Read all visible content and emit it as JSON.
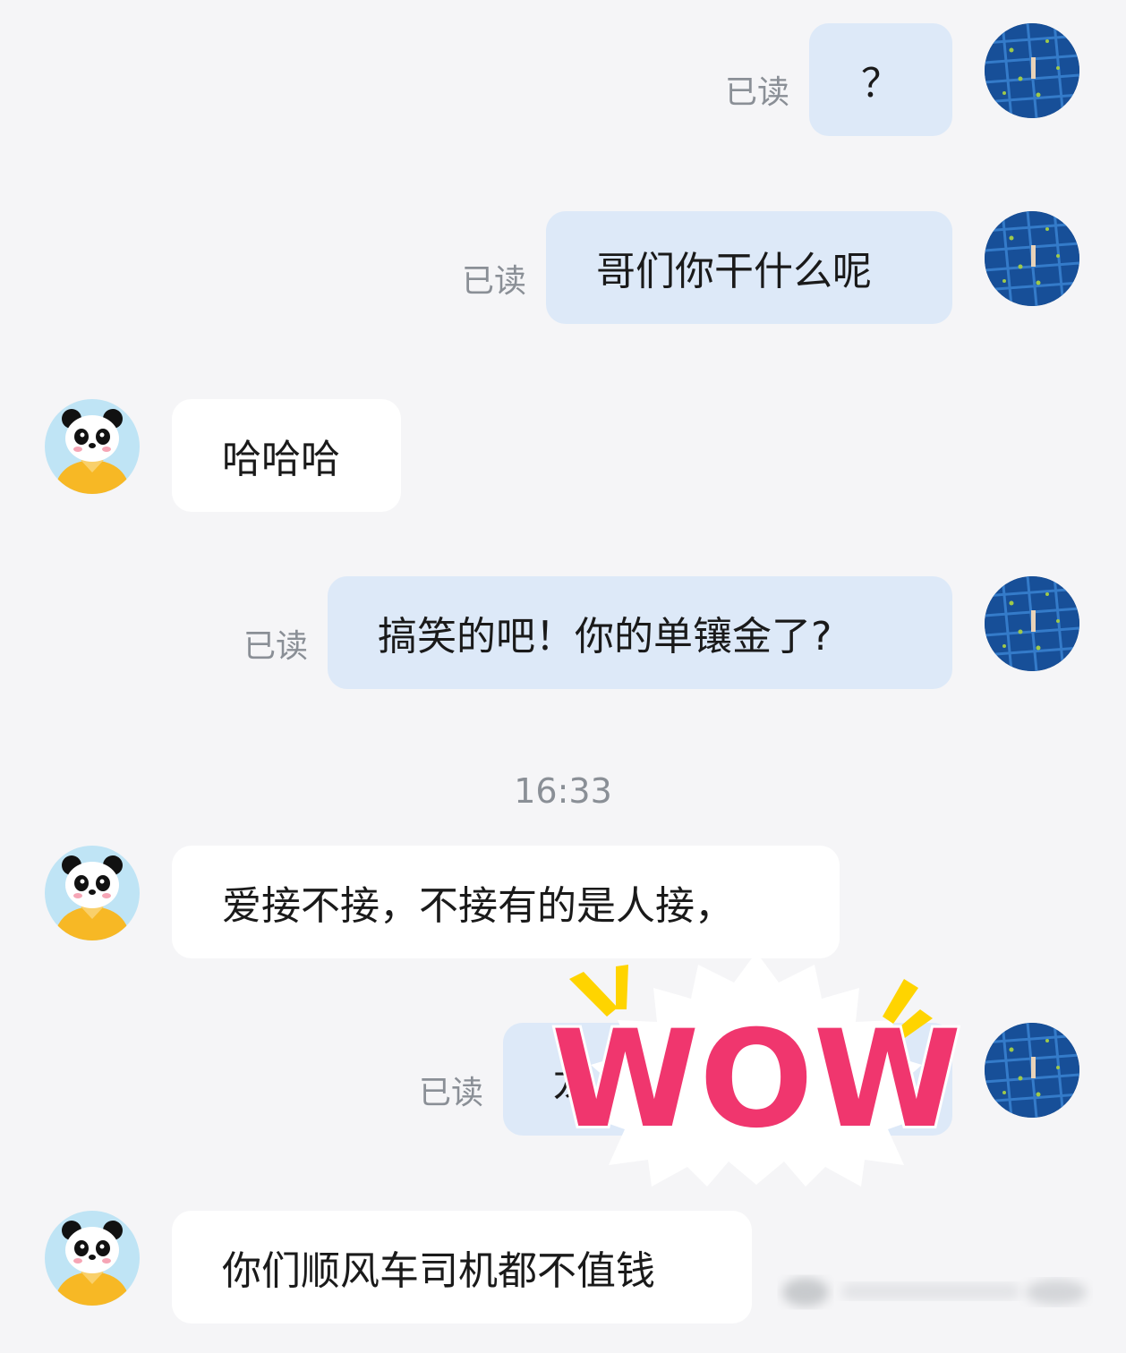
{
  "read_label": "已读",
  "timestamp": "16:33",
  "messages": [
    {
      "side": "out",
      "text": "？",
      "read": "已读"
    },
    {
      "side": "out",
      "text": "哥们你干什么呢",
      "read": "已读"
    },
    {
      "side": "in",
      "text": "哈哈哈"
    },
    {
      "side": "out",
      "text": "搞笑的吧！你的单镶金了?",
      "read": "已读"
    },
    {
      "side": "in",
      "text": "爱接不接，不接有的是人接，"
    },
    {
      "side": "out",
      "text": "龙",
      "read": "已读"
    },
    {
      "side": "in",
      "text": "你们顺风车司机都不值钱"
    }
  ],
  "sticker": {
    "text": "WOW"
  },
  "colors": {
    "out_bubble": "#dde9f8",
    "in_bubble": "#ffffff",
    "sticker_pink": "#f0366e",
    "sticker_yellow": "#ffd400"
  },
  "icons": {
    "self_avatar": "blue-photo-avatar",
    "other_avatar": "panda-avatar"
  }
}
